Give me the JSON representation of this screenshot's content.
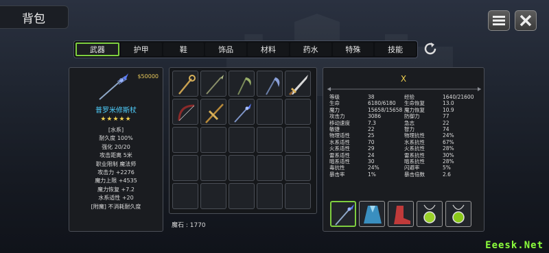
{
  "header": {
    "title": "背包"
  },
  "tabs": [
    "武器",
    "护甲",
    "鞋",
    "饰品",
    "材料",
    "药水",
    "特殊",
    "技能"
  ],
  "item": {
    "price": "$50000",
    "name": "普罗米修斯杖",
    "stars": "★★★★★",
    "props": [
      "[水系]",
      "耐久度 100%",
      "强化 20/20",
      "攻击距离  5米",
      "职业限制   魔法师",
      "攻击力  +2276",
      "魔力上限  +4535",
      "魔力恢复  +7.2",
      "水系适性  +20",
      "[附魔] 不消耗耐久度"
    ]
  },
  "inventory": {
    "mana_stone": "魔石 : 1770",
    "slots": [
      {
        "icon": "golden-staff"
      },
      {
        "icon": "green-spear"
      },
      {
        "icon": "green-scythe"
      },
      {
        "icon": "blue-scythe"
      },
      {
        "icon": "golden-sword"
      },
      {
        "icon": "red-bow"
      },
      {
        "icon": "golden-cross-spear"
      },
      {
        "icon": "blue-magic-staff"
      },
      {},
      {},
      {},
      {},
      {},
      {},
      {},
      {},
      {},
      {},
      {},
      {},
      {},
      {},
      {},
      {},
      {}
    ]
  },
  "character": {
    "name": "X",
    "stats": [
      [
        "等级",
        "38",
        "经验",
        "1640/21600"
      ],
      [
        "生命",
        "6180/6180",
        "生命恢复",
        "13.0"
      ],
      [
        "魔力",
        "15658/15658",
        "魔力恢复",
        "10.9"
      ],
      [
        "攻击力",
        "3086",
        "防御力",
        "77"
      ],
      [
        "移动速度",
        "7.3",
        "急志",
        "22"
      ],
      [
        "敏捷",
        "22",
        "智力",
        "74"
      ],
      [
        "物理适性",
        "25",
        "物理抗性",
        "24%"
      ],
      [
        "水系适性",
        "70",
        "水系抗性",
        "67%"
      ],
      [
        "火系适性",
        "29",
        "火系抗性",
        "28%"
      ],
      [
        "雷系适性",
        "24",
        "雷系抗性",
        "30%"
      ],
      [
        "暗系适性",
        "30",
        "暗系抗性",
        "28%"
      ],
      [
        "毒抗性",
        "24%",
        "闪避率",
        "5%"
      ],
      [
        "暴击率",
        "1%",
        "暴击倍数",
        "2.6"
      ]
    ],
    "equipment": [
      {
        "icon": "staff",
        "selected": true
      },
      {
        "icon": "robe"
      },
      {
        "icon": "boots"
      },
      {
        "icon": "amulet-1"
      },
      {
        "icon": "amulet-2"
      }
    ]
  },
  "watermark": "Eeesk.Net"
}
